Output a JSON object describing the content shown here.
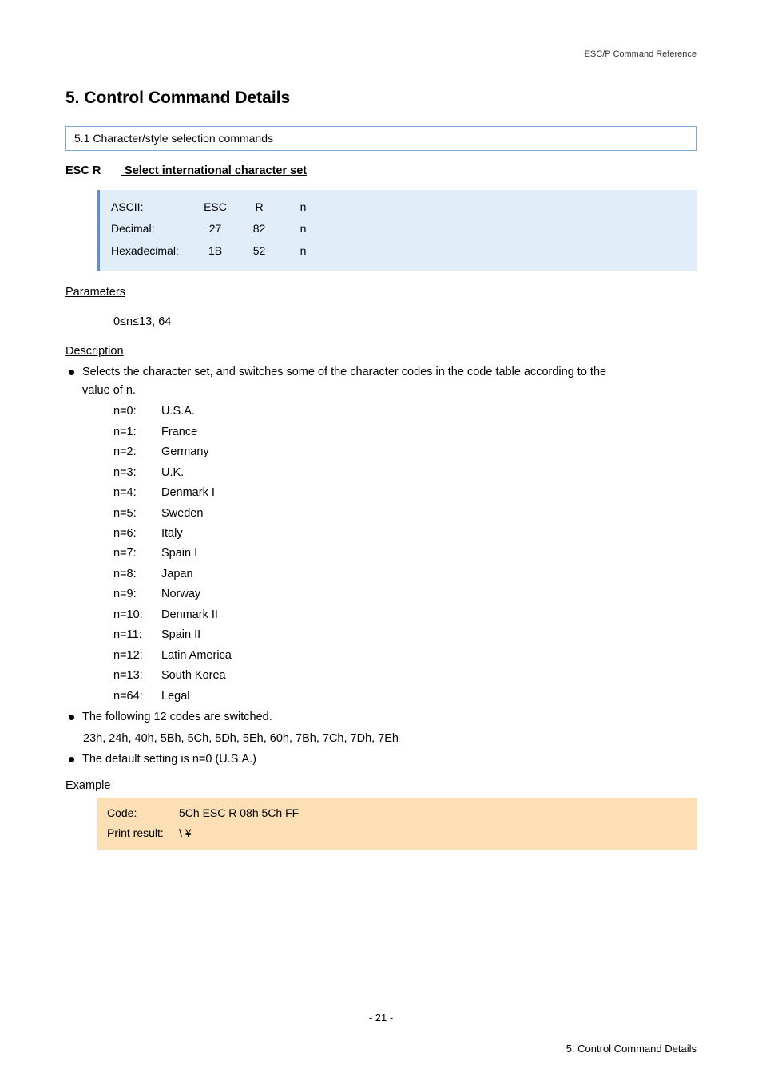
{
  "header_right": "ESC/P Command Reference",
  "h1": "5. Control Command Details",
  "section_bar": "5.1 Character/style selection commands",
  "esc_r_cmd": "ESC R",
  "esc_r_title": "Select international character set",
  "codebox": {
    "rows": [
      {
        "label": "ASCII:",
        "c1": "ESC",
        "c2": "R",
        "c3": "n"
      },
      {
        "label": "Decimal:",
        "c1": "27",
        "c2": "82",
        "c3": "n"
      },
      {
        "label": "Hexadecimal:",
        "c1": "1B",
        "c2": "52",
        "c3": "n"
      }
    ]
  },
  "params_head": "Parameters",
  "params_val": "0≤n≤13, 64",
  "desc_head": "Description",
  "desc_bullet1_a": "Selects the character set, and switches some of the character codes in the code table according to the",
  "desc_bullet1_b": "value of n.",
  "char_sets": [
    {
      "k": "n=0:",
      "v": "U.S.A."
    },
    {
      "k": "n=1:",
      "v": "France"
    },
    {
      "k": "n=2:",
      "v": "Germany"
    },
    {
      "k": "n=3:",
      "v": "U.K."
    },
    {
      "k": "n=4:",
      "v": "Denmark I"
    },
    {
      "k": "n=5:",
      "v": "Sweden"
    },
    {
      "k": "n=6:",
      "v": "Italy"
    },
    {
      "k": "n=7:",
      "v": "Spain I"
    },
    {
      "k": "n=8:",
      "v": "Japan"
    },
    {
      "k": "n=9:",
      "v": "Norway"
    },
    {
      "k": "n=10:",
      "v": "Denmark II"
    },
    {
      "k": "n=11:",
      "v": "Spain II"
    },
    {
      "k": "n=12:",
      "v": "Latin America"
    },
    {
      "k": "n=13:",
      "v": "South Korea"
    },
    {
      "k": "n=64:",
      "v": "Legal"
    }
  ],
  "bullet2": "The following 12 codes are switched.",
  "bullet2_sub": "23h, 24h, 40h, 5Bh, 5Ch, 5Dh, 5Eh, 60h, 7Bh, 7Ch, 7Dh, 7Eh",
  "bullet3": "The default setting is n=0 (U.S.A.)",
  "example_head": "Example",
  "example": {
    "code_label": "Code:",
    "code_val": "5Ch ESC R 08h 5Ch FF",
    "print_label": "Print result:",
    "print_val": "\\  ¥"
  },
  "footer_center": "- 21 -",
  "footer_right": "5. Control Command Details"
}
